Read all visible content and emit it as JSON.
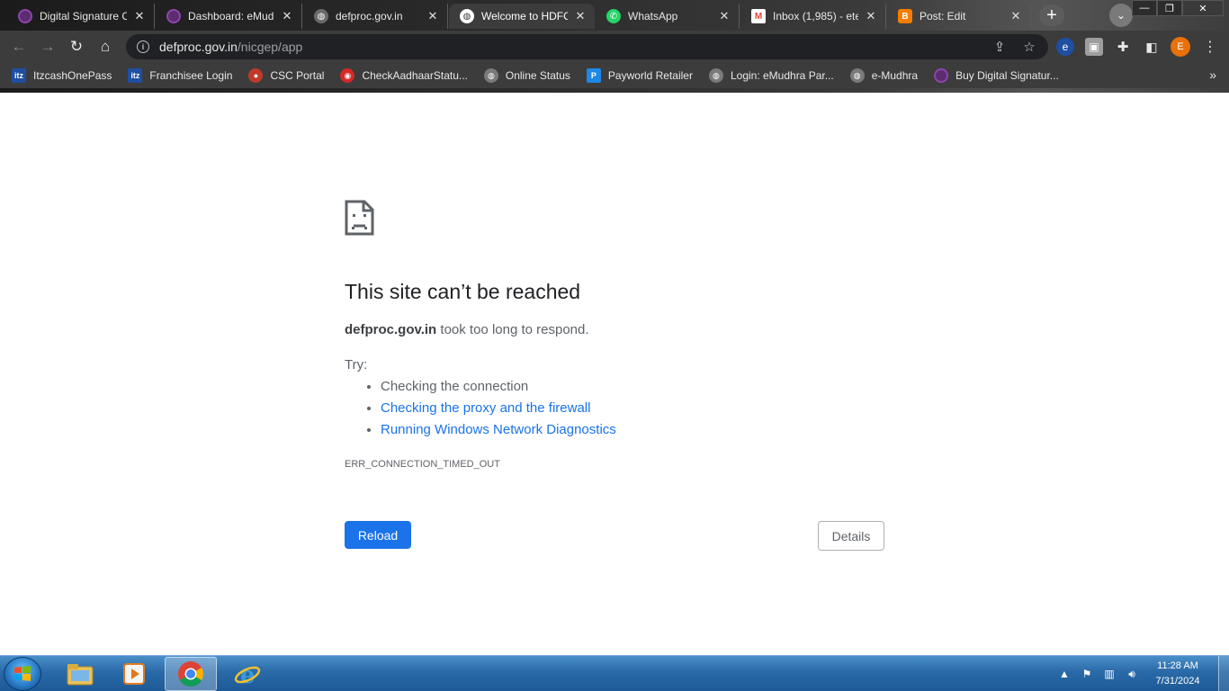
{
  "tabs": [
    {
      "title": "Digital Signature C",
      "favicon": "emudhra-icon",
      "color": "#8e44ad"
    },
    {
      "title": "Dashboard: eMudh",
      "favicon": "emudhra-icon",
      "color": "#8e44ad"
    },
    {
      "title": "defproc.gov.in",
      "favicon": "globe-icon",
      "color": "#7a7a7a"
    },
    {
      "title": "Welcome to HDFC",
      "favicon": "globe-icon",
      "color": "#9e9e9e"
    },
    {
      "title": "WhatsApp",
      "favicon": "whatsapp-icon",
      "color": "#25d366"
    },
    {
      "title": "Inbox (1,985) - ete",
      "favicon": "gmail-icon",
      "color": "#ea4335"
    },
    {
      "title": "Post: Edit",
      "favicon": "blogger-icon",
      "color": "#f57d00"
    }
  ],
  "active_tab_index": 3,
  "toolbar": {
    "url_host": "defproc.gov.in",
    "url_path": "/nicgep/app",
    "profile_initial": "E"
  },
  "bookmarks": [
    {
      "label": "ItzcashOnePass",
      "icon": "itz-icon",
      "color": "#1e4fa3",
      "glyph": "itz"
    },
    {
      "label": "Franchisee Login",
      "icon": "itz-icon",
      "color": "#1e4fa3",
      "glyph": "itz"
    },
    {
      "label": "CSC Portal",
      "icon": "csc-icon",
      "color": "#c0392b",
      "glyph": "●"
    },
    {
      "label": "CheckAadhaarStatu...",
      "icon": "aadhaar-icon",
      "color": "#d62828",
      "glyph": "◉"
    },
    {
      "label": "Online Status",
      "icon": "globe-icon",
      "color": "#7a7a7a",
      "glyph": "◍"
    },
    {
      "label": "Payworld Retailer",
      "icon": "payworld-icon",
      "color": "#1e88e5",
      "glyph": "P"
    },
    {
      "label": "Login: eMudhra Par...",
      "icon": "globe-icon",
      "color": "#7a7a7a",
      "glyph": "◍"
    },
    {
      "label": "e-Mudhra",
      "icon": "globe-icon",
      "color": "#7a7a7a",
      "glyph": "◍"
    },
    {
      "label": "Buy Digital Signatur...",
      "icon": "emudhra-icon",
      "color": "#8e44ad",
      "glyph": "e"
    }
  ],
  "error": {
    "title": "This site can’t be reached",
    "host": "defproc.gov.in",
    "summary_rest": " took too long to respond.",
    "try_label": "Try:",
    "suggestions": [
      {
        "text": "Checking the connection",
        "link": false
      },
      {
        "text": "Checking the proxy and the firewall",
        "link": true
      },
      {
        "text": "Running Windows Network Diagnostics",
        "link": true
      }
    ],
    "code": "ERR_CONNECTION_TIMED_OUT",
    "reload_label": "Reload",
    "details_label": "Details"
  },
  "colors": {
    "link": "#1a73e8",
    "primary_button": "#1a73e8",
    "profile_avatar": "#e8710a"
  },
  "taskbar": {
    "apps": [
      "file-explorer-icon",
      "media-player-icon",
      "chrome-icon",
      "internet-explorer-icon"
    ],
    "active_app": "chrome-icon",
    "time": "11:28 AM",
    "date": "7/31/2024"
  }
}
